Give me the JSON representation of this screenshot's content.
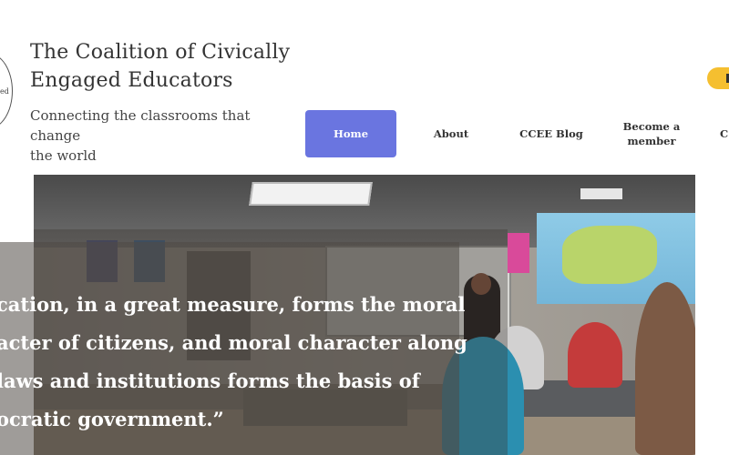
{
  "header": {
    "logo_text": "ed",
    "title_line1": "The Coalition of Civically",
    "title_line2": "Engaged Educators",
    "tagline_line1": "Connecting the classrooms that change",
    "tagline_line2": "the world"
  },
  "nav": {
    "items": [
      {
        "label": "Home",
        "active": true
      },
      {
        "label": "About"
      },
      {
        "label": "CCEE Blog"
      },
      {
        "label_line1": "Become a",
        "label_line2": "member"
      },
      {
        "label": "C"
      }
    ],
    "active_color": "#6a75e0"
  },
  "accent": {
    "pill_color": "#f5bf30"
  },
  "hero": {
    "quote_line1": "cation, in a great measure, forms the moral",
    "quote_line2": "acter of citizens, and moral character along",
    "quote_line3": "laws and institutions forms the basis of",
    "quote_line4": "ocratic government.”"
  }
}
